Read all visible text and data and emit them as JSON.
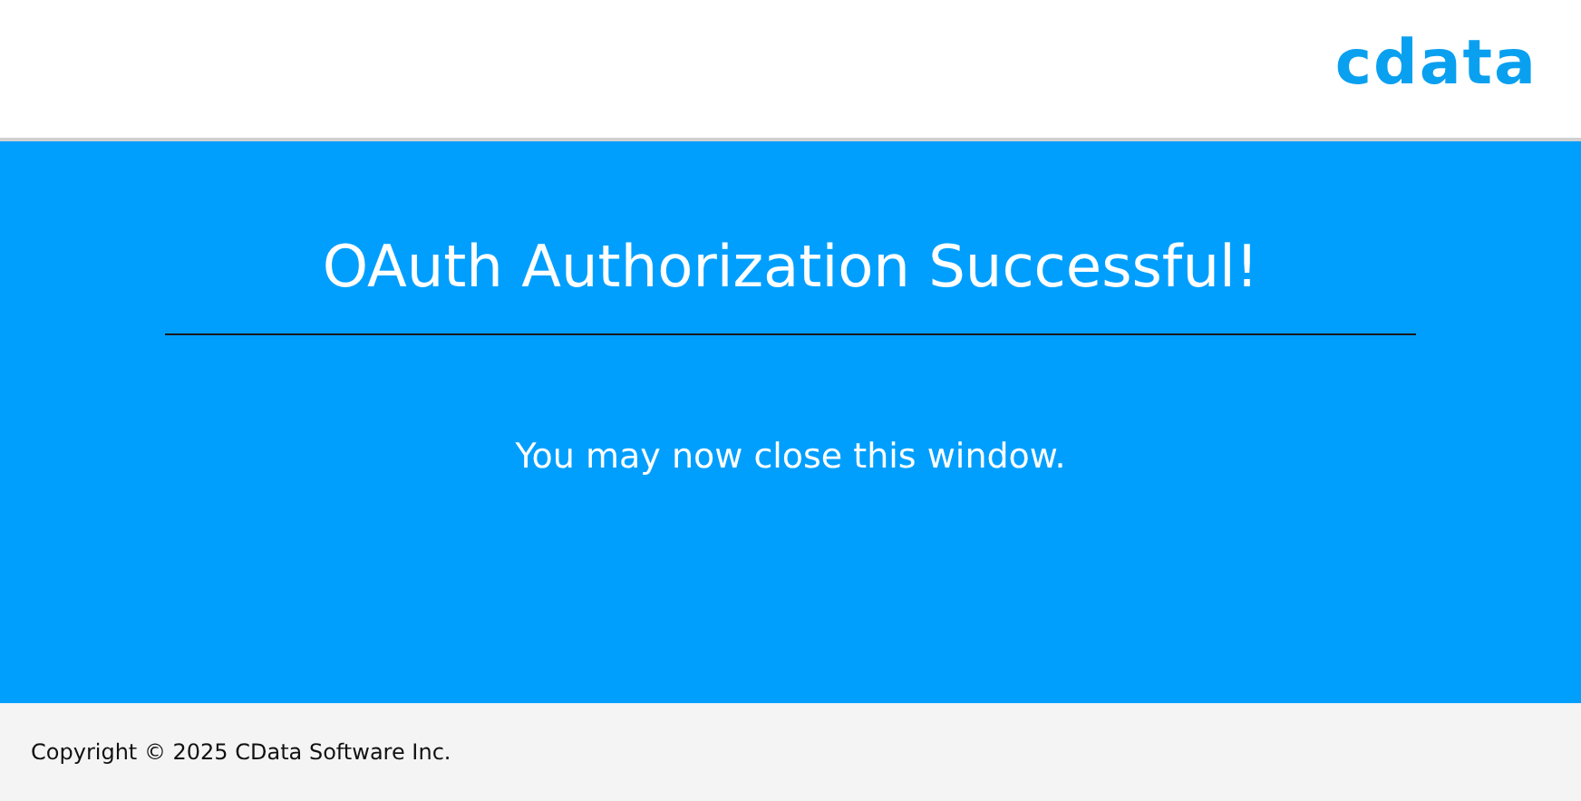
{
  "header": {
    "logo": "cdata"
  },
  "main": {
    "title": "OAuth Authorization Successful!",
    "message": "You may now close this window."
  },
  "footer": {
    "copyright": "Copyright © 2025 CData Software Inc."
  }
}
